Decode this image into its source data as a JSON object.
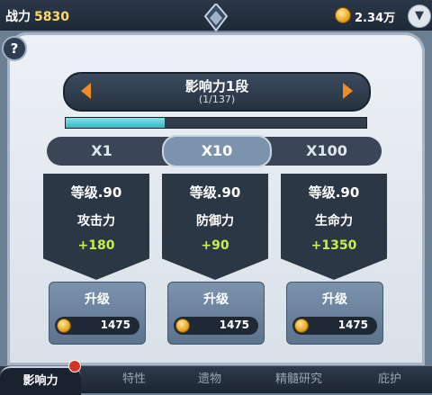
{
  "topbar": {
    "power_label": "战力",
    "power_value": "5830",
    "gold": "2.34万"
  },
  "selector": {
    "title": "影响力1段",
    "progress_text": "(1/137)",
    "progress_fraction": 0.33
  },
  "multipliers": [
    "X1",
    "X10",
    "X100"
  ],
  "selected_multiplier": "X10",
  "cards": [
    {
      "level": "等级.90",
      "stat": "攻击力",
      "bonus": "+180",
      "upgrade": "升级",
      "cost": "1475"
    },
    {
      "level": "等级.90",
      "stat": "防御力",
      "bonus": "+90",
      "upgrade": "升级",
      "cost": "1475"
    },
    {
      "level": "等级.90",
      "stat": "生命力",
      "bonus": "+1350",
      "upgrade": "升级",
      "cost": "1475"
    }
  ],
  "bottom_tabs": [
    "影响力",
    "特性",
    "遗物",
    "精髓研究",
    "庇护"
  ],
  "help": "?",
  "colors": {
    "accent": "#f08a24",
    "bonus": "#c6f04a",
    "progress": "#3fb3c2"
  }
}
